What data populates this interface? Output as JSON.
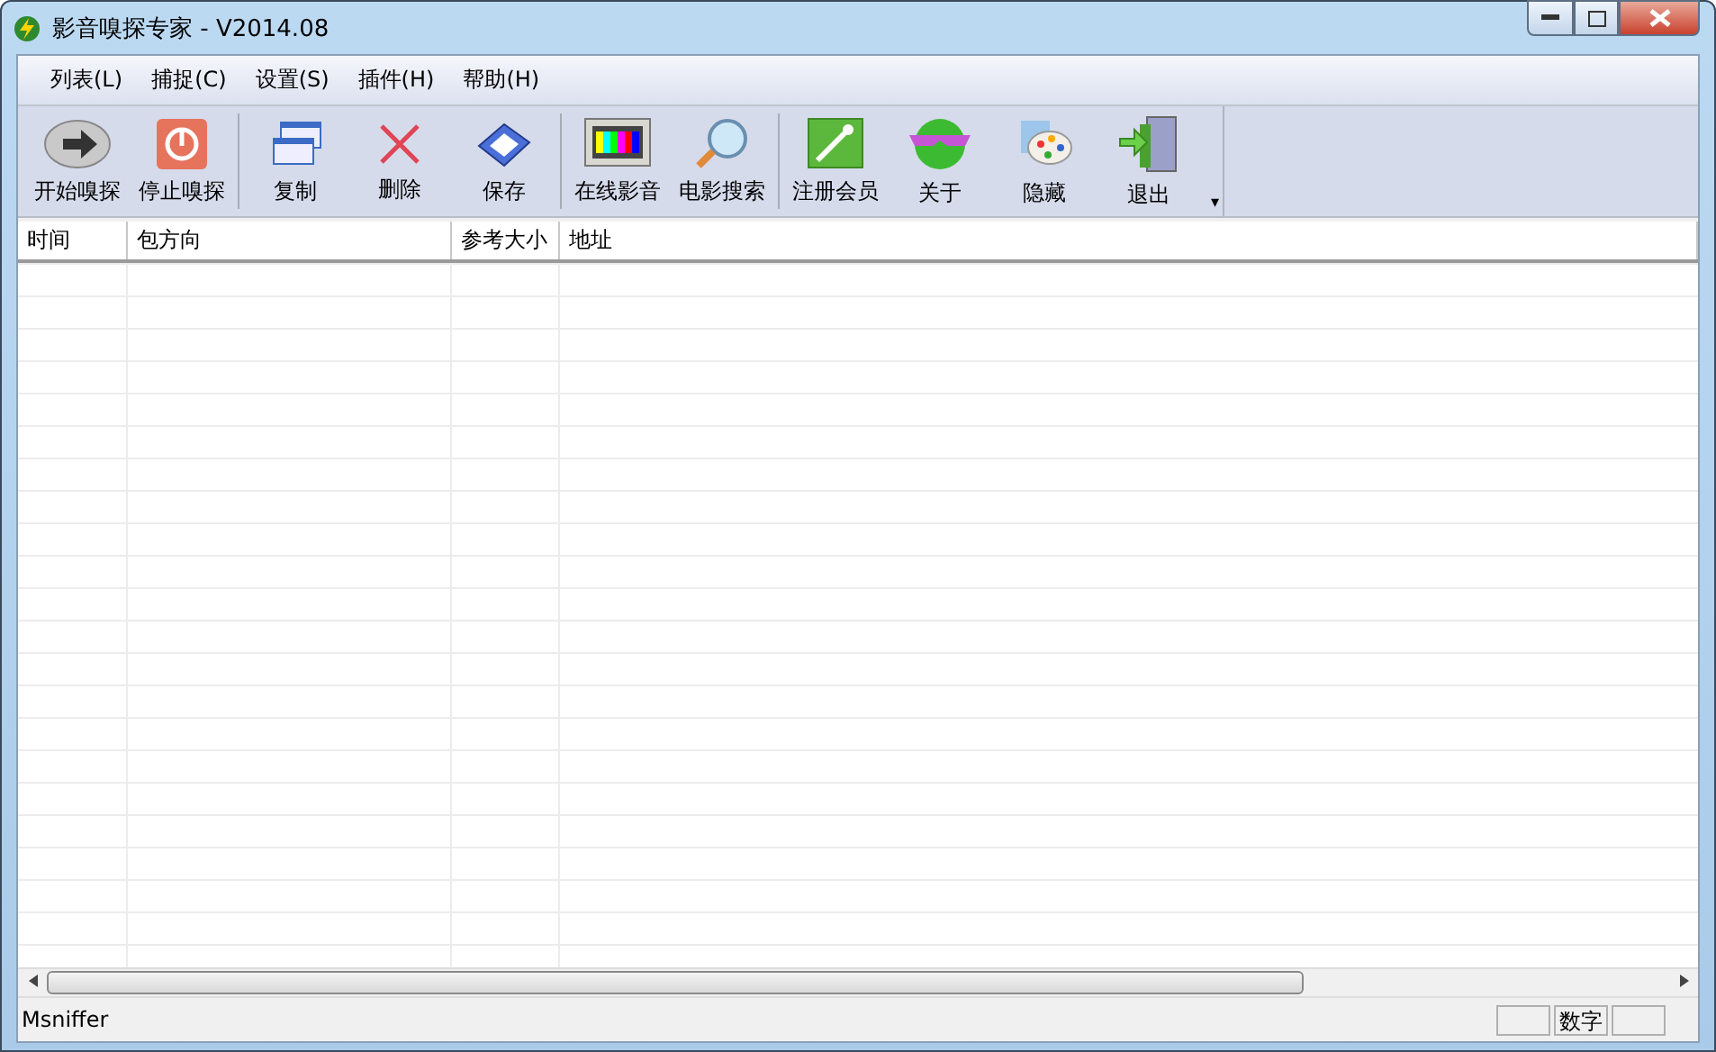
{
  "window": {
    "title": "影音嗅探专家 - V2014.08"
  },
  "menu": [
    "列表(L)",
    "捕捉(C)",
    "设置(S)",
    "插件(H)",
    "帮助(H)"
  ],
  "toolbar": {
    "groups": [
      [
        "开始嗅探",
        "停止嗅探"
      ],
      [
        "复制",
        "删除",
        "保存"
      ],
      [
        "在线影音",
        "电影搜索"
      ],
      [
        "注册会员",
        "关于",
        "隐藏",
        "退出"
      ]
    ],
    "overflow": "▾"
  },
  "table": {
    "columns": [
      "时间",
      "包方向",
      "参考大小",
      "地址"
    ]
  },
  "status_bar": {
    "text": "Msniffer",
    "panels": [
      {
        "kind": "blank"
      },
      {
        "kind": "label",
        "text": "数字"
      },
      {
        "kind": "blank"
      }
    ]
  }
}
